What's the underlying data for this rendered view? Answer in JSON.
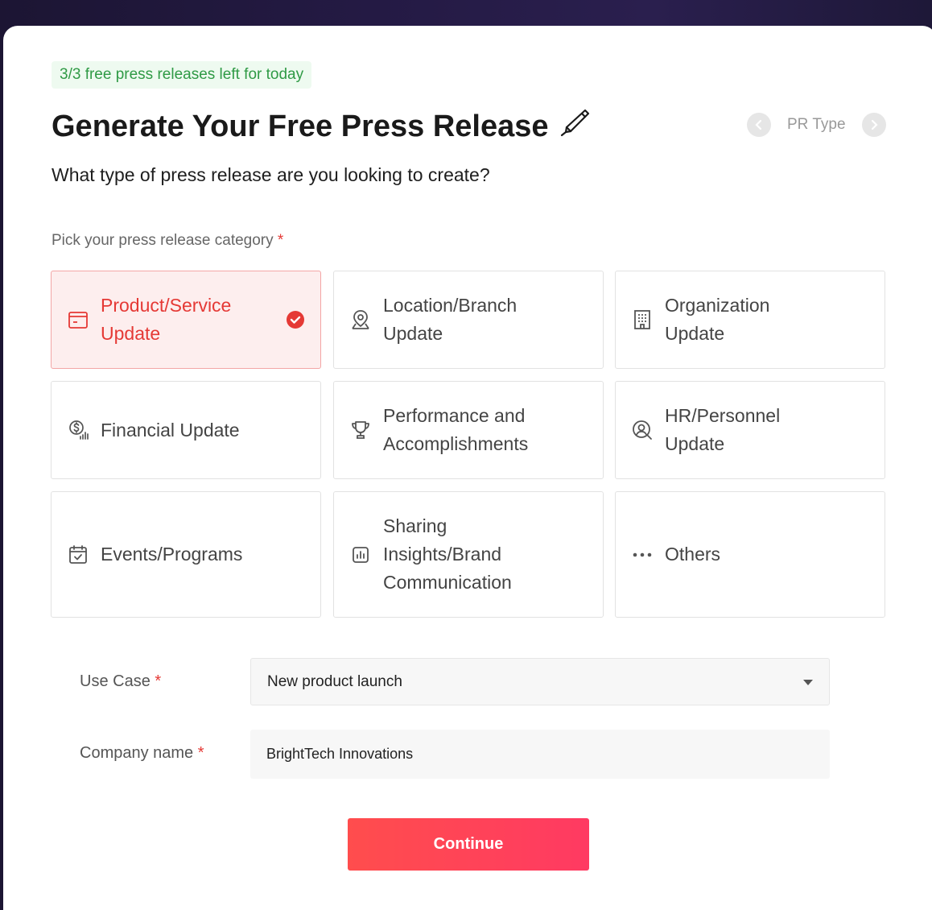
{
  "badge": {
    "text": "3/3 free press releases left for today"
  },
  "header": {
    "title": "Generate Your Free Press Release",
    "title_icon": "pen-icon",
    "pager_label": "PR Type"
  },
  "subtitle": "What type of press release are you looking to create?",
  "category": {
    "label": "Pick your press release category",
    "required_mark": "*",
    "selected_index": 0,
    "items": [
      {
        "label": "Product/Service Update",
        "icon": "product-box-icon",
        "selected": true
      },
      {
        "label": "Location/Branch Update",
        "icon": "location-pin-icon",
        "selected": false
      },
      {
        "label": "Organization Update",
        "icon": "building-icon",
        "selected": false
      },
      {
        "label": "Financial Update",
        "icon": "dollar-chart-icon",
        "selected": false
      },
      {
        "label": "Performance and Accomplishments",
        "icon": "trophy-icon",
        "selected": false
      },
      {
        "label": "HR/Personnel Update",
        "icon": "person-search-icon",
        "selected": false
      },
      {
        "label": "Events/Programs",
        "icon": "calendar-icon",
        "selected": false
      },
      {
        "label": "Sharing Insights/Brand Communication",
        "icon": "bar-chart-icon",
        "selected": false
      },
      {
        "label": "Others",
        "icon": "more-dots-icon",
        "selected": false
      }
    ]
  },
  "form": {
    "use_case_label": "Use Case",
    "use_case_value": "New product launch",
    "company_label": "Company name",
    "company_value": "BrightTech Innovations",
    "required_mark": "*"
  },
  "continue_label": "Continue",
  "colors": {
    "accent": "#e53935",
    "badge_text": "#2f9a45",
    "button_start": "#ff4d4d",
    "button_end": "#ff3a62"
  }
}
